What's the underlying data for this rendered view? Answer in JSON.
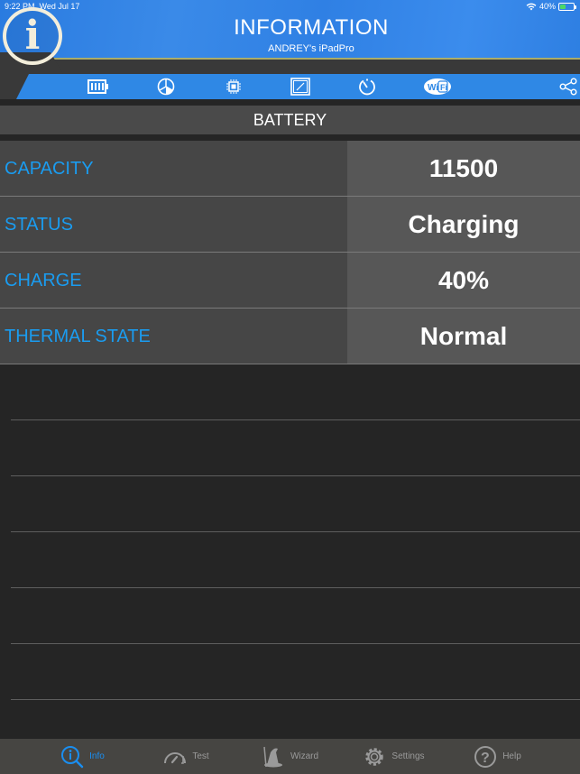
{
  "status_bar": {
    "time": "9:22 PM",
    "date": "Wed Jul 17",
    "battery_percent": "40%",
    "battery_level": 0.4
  },
  "header": {
    "title": "INFORMATION",
    "subtitle": "ANDREY's iPadPro",
    "logo_icon": "info-icon"
  },
  "toolbar": {
    "icons": [
      "battery-icon",
      "storage-pie-icon",
      "cpu-chip-icon",
      "display-icon",
      "timer-icon",
      "wifi-icon",
      "share-icon"
    ]
  },
  "section": {
    "title": "BATTERY"
  },
  "rows": [
    {
      "label": "CAPACITY",
      "value": "11500"
    },
    {
      "label": "STATUS",
      "value": "Charging"
    },
    {
      "label": "CHARGE",
      "value": "40%"
    },
    {
      "label": "THERMAL STATE",
      "value": "Normal"
    }
  ],
  "tabbar": {
    "tabs": [
      {
        "label": "Info",
        "icon": "info-search-icon",
        "active": true
      },
      {
        "label": "Test",
        "icon": "speedometer-icon",
        "active": false
      },
      {
        "label": "Wizard",
        "icon": "wizard-hat-icon",
        "active": false
      },
      {
        "label": "Settings",
        "icon": "gear-icon",
        "active": false
      },
      {
        "label": "Help",
        "icon": "help-icon",
        "active": false
      }
    ]
  },
  "colors": {
    "accent": "#1a9cf0",
    "header_blue": "#2f88e5",
    "tab_active": "#1a8ef0"
  }
}
